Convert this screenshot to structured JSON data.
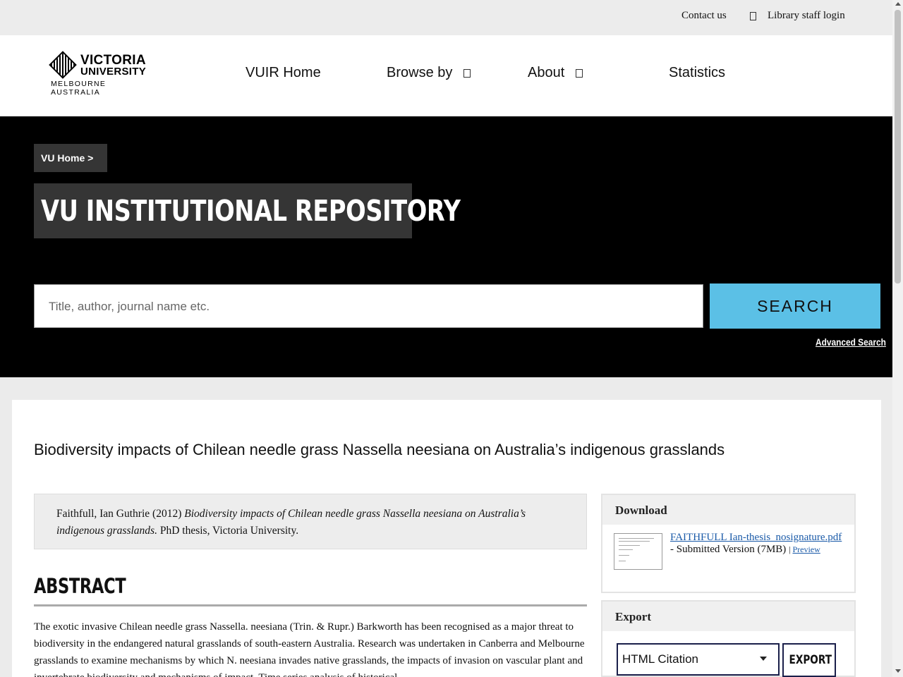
{
  "topbar": {
    "contact": "Contact us",
    "staff_login": "Library staff login"
  },
  "logo": {
    "line1": "VICTORIA",
    "line2": "UNIVERSITY",
    "line3": "MELBOURNE AUSTRALIA"
  },
  "nav": {
    "items": [
      {
        "label": "VUIR Home",
        "icon": "none"
      },
      {
        "label": "Browse by",
        "icon": "chevron-down-icon"
      },
      {
        "label": "About",
        "icon": "chevron-down-icon"
      },
      {
        "label": "Statistics",
        "icon": "none"
      }
    ]
  },
  "hero": {
    "breadcrumb": "VU Home  >",
    "title": "VU INSTITUTIONAL REPOSITORY",
    "search_placeholder": "Title, author, journal name etc.",
    "search_button": "SEARCH",
    "advanced_search": "Advanced Search",
    "accent_color": "#5bc0e6"
  },
  "item": {
    "title": "Biodiversity impacts of Chilean needle grass Nassella neesiana on Australia’s indigenous grasslands",
    "citation": {
      "authors_year": "Faithfull, Ian Guthrie (2012) ",
      "title_italic": "Biodiversity impacts of Chilean needle grass Nassella neesiana on Australia’s indigenous grasslands.",
      "tail": " PhD thesis, Victoria University."
    },
    "abstract_heading": "ABSTRACT",
    "abstract_text": "The exotic invasive Chilean needle grass Nassella. neesiana (Trin. & Rupr.) Barkworth has been recognised as a major threat to biodiversity in the endangered natural grasslands of south-eastern Australia. Research was undertaken in Canberra and Melbourne grasslands to examine mechanisms by which N. neesiana invades native grasslands, the impacts of invasion on vascular plant and invertebrate biodiversity and mechanisms of impact. Time series analysis of historical"
  },
  "download": {
    "heading": "Download",
    "file_link": "FAITHFULL Ian-thesis_nosignature.pdf",
    "version": " - Submitted Version (7MB) ",
    "sep": "| ",
    "preview": "Preview"
  },
  "export": {
    "heading": "Export",
    "selected_format": "HTML Citation",
    "button": "EXPORT"
  }
}
